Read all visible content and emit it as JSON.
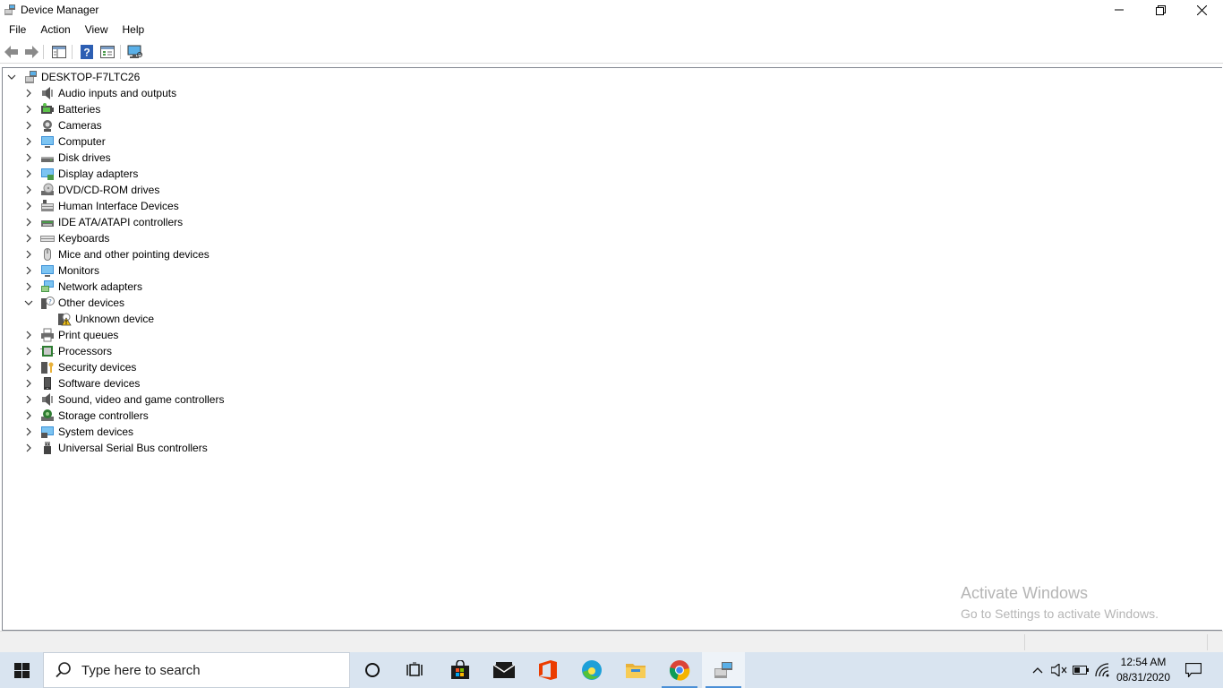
{
  "window": {
    "title": "Device Manager"
  },
  "window_controls": {
    "minimize": "minimize",
    "restore": "restore",
    "close": "close"
  },
  "menu": [
    "File",
    "Action",
    "View",
    "Help"
  ],
  "toolbar": {
    "buttons": [
      "back-arrow-icon",
      "forward-arrow-icon",
      "console-tree-icon",
      "help-icon",
      "properties-icon",
      "monitor-scan-icon"
    ]
  },
  "tree": {
    "root": "DESKTOP-F7LTC26",
    "categories": [
      {
        "label": "Audio inputs and outputs",
        "icon": "speaker"
      },
      {
        "label": "Batteries",
        "icon": "battery"
      },
      {
        "label": "Cameras",
        "icon": "camera"
      },
      {
        "label": "Computer",
        "icon": "computer"
      },
      {
        "label": "Disk drives",
        "icon": "disk"
      },
      {
        "label": "Display adapters",
        "icon": "display"
      },
      {
        "label": "DVD/CD-ROM drives",
        "icon": "dvd"
      },
      {
        "label": "Human Interface Devices",
        "icon": "hid"
      },
      {
        "label": "IDE ATA/ATAPI controllers",
        "icon": "ide"
      },
      {
        "label": "Keyboards",
        "icon": "keyboard"
      },
      {
        "label": "Mice and other pointing devices",
        "icon": "mouse"
      },
      {
        "label": "Monitors",
        "icon": "monitor"
      },
      {
        "label": "Network adapters",
        "icon": "network"
      },
      {
        "label": "Other devices",
        "icon": "other",
        "expanded": true
      },
      {
        "label": "Unknown device",
        "icon": "unknown-warning",
        "child": true
      },
      {
        "label": "Print queues",
        "icon": "printer"
      },
      {
        "label": "Processors",
        "icon": "processor"
      },
      {
        "label": "Security devices",
        "icon": "security"
      },
      {
        "label": "Software devices",
        "icon": "software"
      },
      {
        "label": "Sound, video and game controllers",
        "icon": "speaker"
      },
      {
        "label": "Storage controllers",
        "icon": "storage"
      },
      {
        "label": "System devices",
        "icon": "system"
      },
      {
        "label": "Universal Serial Bus controllers",
        "icon": "usb"
      }
    ]
  },
  "watermark": {
    "line1": "Activate Windows",
    "line2": "Go to Settings to activate Windows."
  },
  "taskbar": {
    "search_placeholder": "Type here to search",
    "apps": [
      "cortana",
      "task-view",
      "store",
      "mail",
      "office",
      "edge",
      "file-explorer",
      "chrome",
      "device-manager"
    ],
    "clock": {
      "time": "12:54 AM",
      "date": "08/31/2020"
    }
  },
  "colors": {
    "taskbar": "#d9e4f0",
    "accent": "#4a8fd6",
    "watermark": "#b5b5b5"
  }
}
